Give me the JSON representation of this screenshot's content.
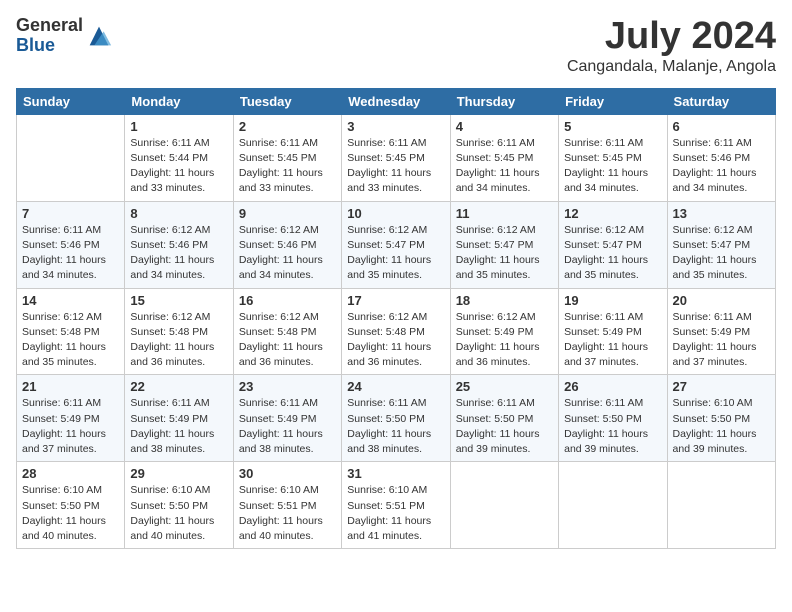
{
  "logo": {
    "general": "General",
    "blue": "Blue"
  },
  "title": "July 2024",
  "subtitle": "Cangandala, Malanje, Angola",
  "headers": [
    "Sunday",
    "Monday",
    "Tuesday",
    "Wednesday",
    "Thursday",
    "Friday",
    "Saturday"
  ],
  "weeks": [
    [
      {
        "day": "",
        "info": ""
      },
      {
        "day": "1",
        "info": "Sunrise: 6:11 AM\nSunset: 5:44 PM\nDaylight: 11 hours\nand 33 minutes."
      },
      {
        "day": "2",
        "info": "Sunrise: 6:11 AM\nSunset: 5:45 PM\nDaylight: 11 hours\nand 33 minutes."
      },
      {
        "day": "3",
        "info": "Sunrise: 6:11 AM\nSunset: 5:45 PM\nDaylight: 11 hours\nand 33 minutes."
      },
      {
        "day": "4",
        "info": "Sunrise: 6:11 AM\nSunset: 5:45 PM\nDaylight: 11 hours\nand 34 minutes."
      },
      {
        "day": "5",
        "info": "Sunrise: 6:11 AM\nSunset: 5:45 PM\nDaylight: 11 hours\nand 34 minutes."
      },
      {
        "day": "6",
        "info": "Sunrise: 6:11 AM\nSunset: 5:46 PM\nDaylight: 11 hours\nand 34 minutes."
      }
    ],
    [
      {
        "day": "7",
        "info": "Sunrise: 6:11 AM\nSunset: 5:46 PM\nDaylight: 11 hours\nand 34 minutes."
      },
      {
        "day": "8",
        "info": "Sunrise: 6:12 AM\nSunset: 5:46 PM\nDaylight: 11 hours\nand 34 minutes."
      },
      {
        "day": "9",
        "info": "Sunrise: 6:12 AM\nSunset: 5:46 PM\nDaylight: 11 hours\nand 34 minutes."
      },
      {
        "day": "10",
        "info": "Sunrise: 6:12 AM\nSunset: 5:47 PM\nDaylight: 11 hours\nand 35 minutes."
      },
      {
        "day": "11",
        "info": "Sunrise: 6:12 AM\nSunset: 5:47 PM\nDaylight: 11 hours\nand 35 minutes."
      },
      {
        "day": "12",
        "info": "Sunrise: 6:12 AM\nSunset: 5:47 PM\nDaylight: 11 hours\nand 35 minutes."
      },
      {
        "day": "13",
        "info": "Sunrise: 6:12 AM\nSunset: 5:47 PM\nDaylight: 11 hours\nand 35 minutes."
      }
    ],
    [
      {
        "day": "14",
        "info": "Sunrise: 6:12 AM\nSunset: 5:48 PM\nDaylight: 11 hours\nand 35 minutes."
      },
      {
        "day": "15",
        "info": "Sunrise: 6:12 AM\nSunset: 5:48 PM\nDaylight: 11 hours\nand 36 minutes."
      },
      {
        "day": "16",
        "info": "Sunrise: 6:12 AM\nSunset: 5:48 PM\nDaylight: 11 hours\nand 36 minutes."
      },
      {
        "day": "17",
        "info": "Sunrise: 6:12 AM\nSunset: 5:48 PM\nDaylight: 11 hours\nand 36 minutes."
      },
      {
        "day": "18",
        "info": "Sunrise: 6:12 AM\nSunset: 5:49 PM\nDaylight: 11 hours\nand 36 minutes."
      },
      {
        "day": "19",
        "info": "Sunrise: 6:11 AM\nSunset: 5:49 PM\nDaylight: 11 hours\nand 37 minutes."
      },
      {
        "day": "20",
        "info": "Sunrise: 6:11 AM\nSunset: 5:49 PM\nDaylight: 11 hours\nand 37 minutes."
      }
    ],
    [
      {
        "day": "21",
        "info": "Sunrise: 6:11 AM\nSunset: 5:49 PM\nDaylight: 11 hours\nand 37 minutes."
      },
      {
        "day": "22",
        "info": "Sunrise: 6:11 AM\nSunset: 5:49 PM\nDaylight: 11 hours\nand 38 minutes."
      },
      {
        "day": "23",
        "info": "Sunrise: 6:11 AM\nSunset: 5:49 PM\nDaylight: 11 hours\nand 38 minutes."
      },
      {
        "day": "24",
        "info": "Sunrise: 6:11 AM\nSunset: 5:50 PM\nDaylight: 11 hours\nand 38 minutes."
      },
      {
        "day": "25",
        "info": "Sunrise: 6:11 AM\nSunset: 5:50 PM\nDaylight: 11 hours\nand 39 minutes."
      },
      {
        "day": "26",
        "info": "Sunrise: 6:11 AM\nSunset: 5:50 PM\nDaylight: 11 hours\nand 39 minutes."
      },
      {
        "day": "27",
        "info": "Sunrise: 6:10 AM\nSunset: 5:50 PM\nDaylight: 11 hours\nand 39 minutes."
      }
    ],
    [
      {
        "day": "28",
        "info": "Sunrise: 6:10 AM\nSunset: 5:50 PM\nDaylight: 11 hours\nand 40 minutes."
      },
      {
        "day": "29",
        "info": "Sunrise: 6:10 AM\nSunset: 5:50 PM\nDaylight: 11 hours\nand 40 minutes."
      },
      {
        "day": "30",
        "info": "Sunrise: 6:10 AM\nSunset: 5:51 PM\nDaylight: 11 hours\nand 40 minutes."
      },
      {
        "day": "31",
        "info": "Sunrise: 6:10 AM\nSunset: 5:51 PM\nDaylight: 11 hours\nand 41 minutes."
      },
      {
        "day": "",
        "info": ""
      },
      {
        "day": "",
        "info": ""
      },
      {
        "day": "",
        "info": ""
      }
    ]
  ]
}
